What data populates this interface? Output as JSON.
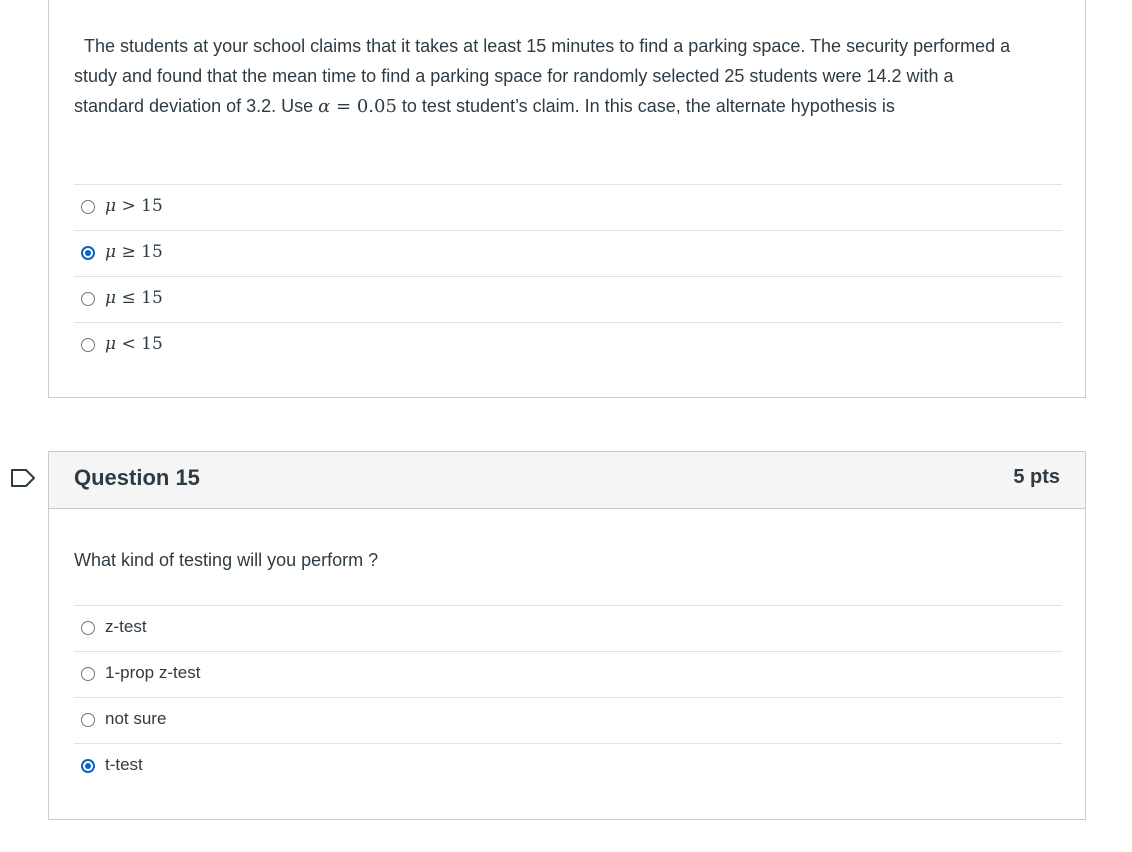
{
  "question14": {
    "text_part1": "The students at your school claims that it takes at least 15 minutes to find a parking space. The security performed a study and found that the mean time to find  a parking space for randomly selected 25 students were 14.2 with a standard deviation of 3.2. Use ",
    "alpha_symbol": "α",
    "alpha_eq": " = ",
    "alpha_value": "0.05",
    "text_part2": " to test student’s claim. In this case, the alternate hypothesis is",
    "answers": [
      {
        "var": "μ",
        "op": " > ",
        "num": "15",
        "selected": false
      },
      {
        "var": "μ",
        "op": " ≥ ",
        "num": "15",
        "selected": true
      },
      {
        "var": "μ",
        "op": " ≤ ",
        "num": "15",
        "selected": false
      },
      {
        "var": "μ",
        "op": " < ",
        "num": "15",
        "selected": false
      }
    ]
  },
  "question15": {
    "title": "Question 15",
    "points": "5 pts",
    "text": "What kind of testing  will you perform ?",
    "answers": [
      {
        "label": "z-test",
        "selected": false
      },
      {
        "label": "1-prop z-test",
        "selected": false
      },
      {
        "label": "not sure",
        "selected": false
      },
      {
        "label": "t-test",
        "selected": true
      }
    ]
  },
  "icons": {
    "flag": "bookmark-flag-icon"
  },
  "colors": {
    "accent": "#0b62c4",
    "text": "#2d3b45",
    "border": "#c7cdd1",
    "header_bg": "#f5f5f5"
  }
}
